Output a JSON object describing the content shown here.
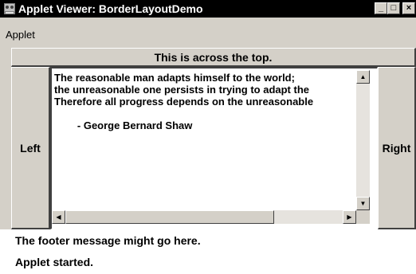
{
  "window": {
    "title": "Applet Viewer: BorderLayoutDemo",
    "controls": {
      "minimize": "_",
      "maximize": "□",
      "close": "×"
    }
  },
  "menu": {
    "items": [
      "Applet"
    ]
  },
  "layout": {
    "top_button": "This is across the top.",
    "left_button": "Left",
    "right_button": "Right"
  },
  "text_area": {
    "lines": [
      "The reasonable man adapts himself to the world;",
      "the unreasonable one persists in trying to adapt the",
      "Therefore all progress depends on the unreasonable",
      "",
      "        - George Bernard Shaw"
    ]
  },
  "footer": {
    "message": "The footer message might go here."
  },
  "status": {
    "text": "Applet started."
  },
  "icons": {
    "title": "applet-icon",
    "scroll_up": "arrow-up-icon",
    "scroll_down": "arrow-down-icon",
    "scroll_left": "arrow-left-icon",
    "scroll_right": "arrow-right-icon"
  },
  "colors": {
    "titlebar": "#000000",
    "face": "#d4d0c8",
    "text_bg": "#ffffff"
  }
}
